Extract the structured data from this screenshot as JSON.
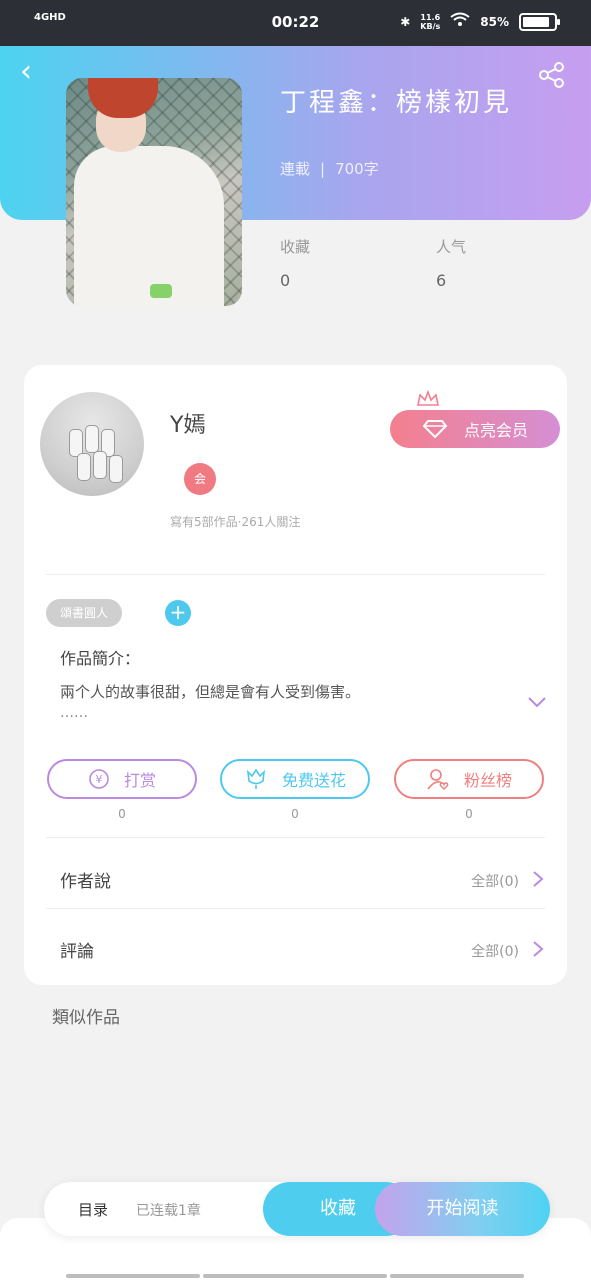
{
  "status_bar": {
    "network": "4GHD",
    "time": "00:22",
    "speed": "11.6",
    "speed_unit": "KB/s",
    "battery_text": "85%",
    "battery_level": 0.85
  },
  "book": {
    "title": "丁程鑫：榜樣初見",
    "status": "連載",
    "word_count": "700字",
    "stats": [
      {
        "label": "收藏",
        "value": "0"
      },
      {
        "label": "人气",
        "value": "6"
      }
    ]
  },
  "author": {
    "name": "Y嫣",
    "badge": "会",
    "info": "寫有5部作品·261人關注",
    "vip_label": "点亮会员"
  },
  "intro": {
    "tag": "頌書圓人",
    "add_symbol": "+",
    "title": "作品簡介：",
    "text": "兩个人的故事很甜，但總是會有人受到傷害。",
    "more": "……"
  },
  "actions": [
    {
      "label": "打赏",
      "count": "0",
      "icon": "yen-icon",
      "color": "#b98ae0"
    },
    {
      "label": "免费送花",
      "count": "0",
      "icon": "flower-icon",
      "color": "#4fc8ee"
    },
    {
      "label": "粉丝榜",
      "count": "0",
      "icon": "fan-user-icon",
      "color": "#f0807f"
    }
  ],
  "rows": [
    {
      "label": "作者說",
      "value": "全部(0)"
    },
    {
      "label": "評論",
      "value": "全部(0)"
    }
  ],
  "similar_title": "類似作品",
  "bottom_bar": {
    "catalog": "目录",
    "progress": "已连载1章",
    "collect": "收藏",
    "read": "开始阅读"
  },
  "colors": {
    "accent_blue": "#4fcdef",
    "accent_purple": "#c79ef0",
    "accent_pink": "#f47f8e"
  }
}
